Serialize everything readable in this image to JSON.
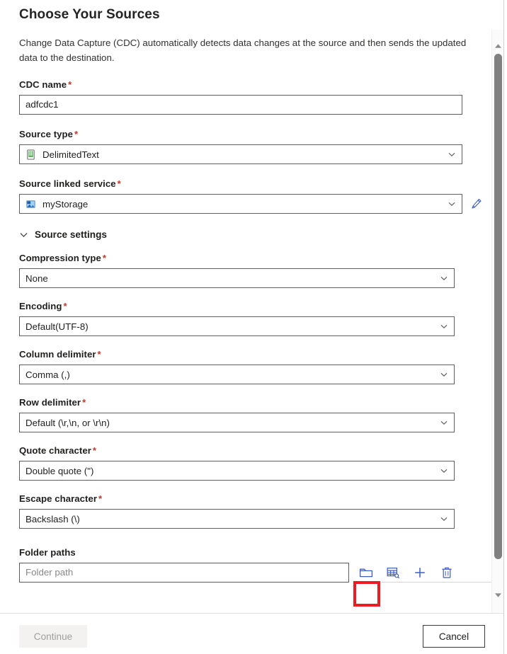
{
  "page": {
    "title": "Choose Your Sources",
    "description": "Change Data Capture (CDC) automatically detects data changes at the source and then sends the updated data to the destination."
  },
  "fields": {
    "cdc_name": {
      "label": "CDC name",
      "required": "*",
      "value": "adfcdc1"
    },
    "source_type": {
      "label": "Source type",
      "required": "*",
      "value": "DelimitedText",
      "icon": "delimited-text-icon"
    },
    "source_linked_service": {
      "label": "Source linked service",
      "required": "*",
      "value": "myStorage",
      "icon": "storage-account-icon",
      "edit_icon": "pencil-icon"
    }
  },
  "source_settings": {
    "title": "Source settings",
    "expanded": true,
    "caret_icon": "chevron-down-icon",
    "fields": [
      {
        "label": "Compression type",
        "required": "*",
        "value": "None"
      },
      {
        "label": "Encoding",
        "required": "*",
        "value": "Default(UTF-8)"
      },
      {
        "label": "Column delimiter",
        "required": "*",
        "value": "Comma (,)"
      },
      {
        "label": "Row delimiter",
        "required": "*",
        "value": "Default (\\r,\\n, or \\r\\n)"
      },
      {
        "label": "Quote character",
        "required": "*",
        "value": "Double quote (\")"
      },
      {
        "label": "Escape character",
        "required": "*",
        "value": "Backslash (\\)"
      }
    ]
  },
  "folder_paths": {
    "label": "Folder paths",
    "input_placeholder": "Folder path",
    "input_value": "",
    "actions": [
      {
        "name": "browse-folder-icon",
        "tooltip": "Browse",
        "highlighted": true
      },
      {
        "name": "preview-data-icon",
        "tooltip": "Preview data",
        "highlighted": false
      },
      {
        "name": "add-icon",
        "tooltip": "Add",
        "highlighted": false
      },
      {
        "name": "delete-icon",
        "tooltip": "Delete",
        "highlighted": false
      }
    ],
    "highlight_color": "#ec1c24"
  },
  "footer": {
    "continue_label": "Continue",
    "continue_disabled": true,
    "cancel_label": "Cancel"
  },
  "scrollbar": {
    "up_arrow_icon": "scroll-up-arrow-icon",
    "down_arrow_icon": "scroll-down-arrow-icon"
  }
}
